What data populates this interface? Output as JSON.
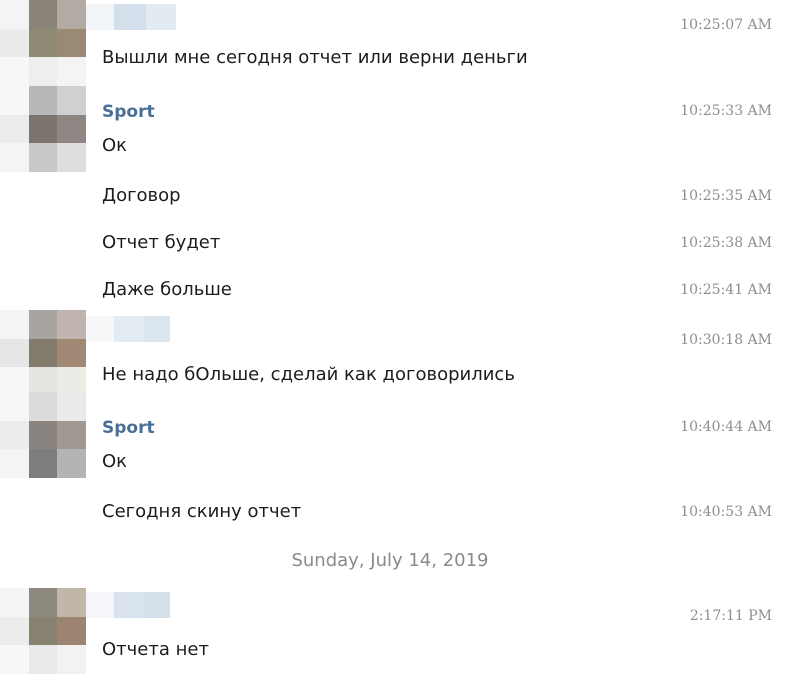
{
  "colors": {
    "sender_name": "#4a6f96",
    "message_text": "#1c1c1c",
    "timestamp": "#8e8e8e",
    "date_separator": "#8a8a8a",
    "background": "#ffffff"
  },
  "messages": [
    {
      "sender": "",
      "text": "Вышли мне сегодня отчет или верни деньги",
      "time": "10:25:07 AM"
    },
    {
      "sender": "Sport",
      "text": "Ок",
      "time": "10:25:33 AM"
    },
    {
      "sender": "",
      "text": "Договор",
      "time": "10:25:35 AM"
    },
    {
      "sender": "",
      "text": "Отчет будет",
      "time": "10:25:38 AM"
    },
    {
      "sender": "",
      "text": "Даже больше",
      "time": "10:25:41 AM"
    },
    {
      "sender": "",
      "text": "Не надо бОльше, сделай как договорились",
      "time": "10:30:18 AM"
    },
    {
      "sender": "Sport",
      "text": "Ок",
      "time": "10:40:44 AM"
    },
    {
      "sender": "",
      "text": "Сегодня скину отчет",
      "time": "10:40:53 AM"
    },
    {
      "sender": "",
      "text": "Отчета нет",
      "time": "2:17:11 PM"
    }
  ],
  "date_separator": "Sunday, July 14, 2019"
}
